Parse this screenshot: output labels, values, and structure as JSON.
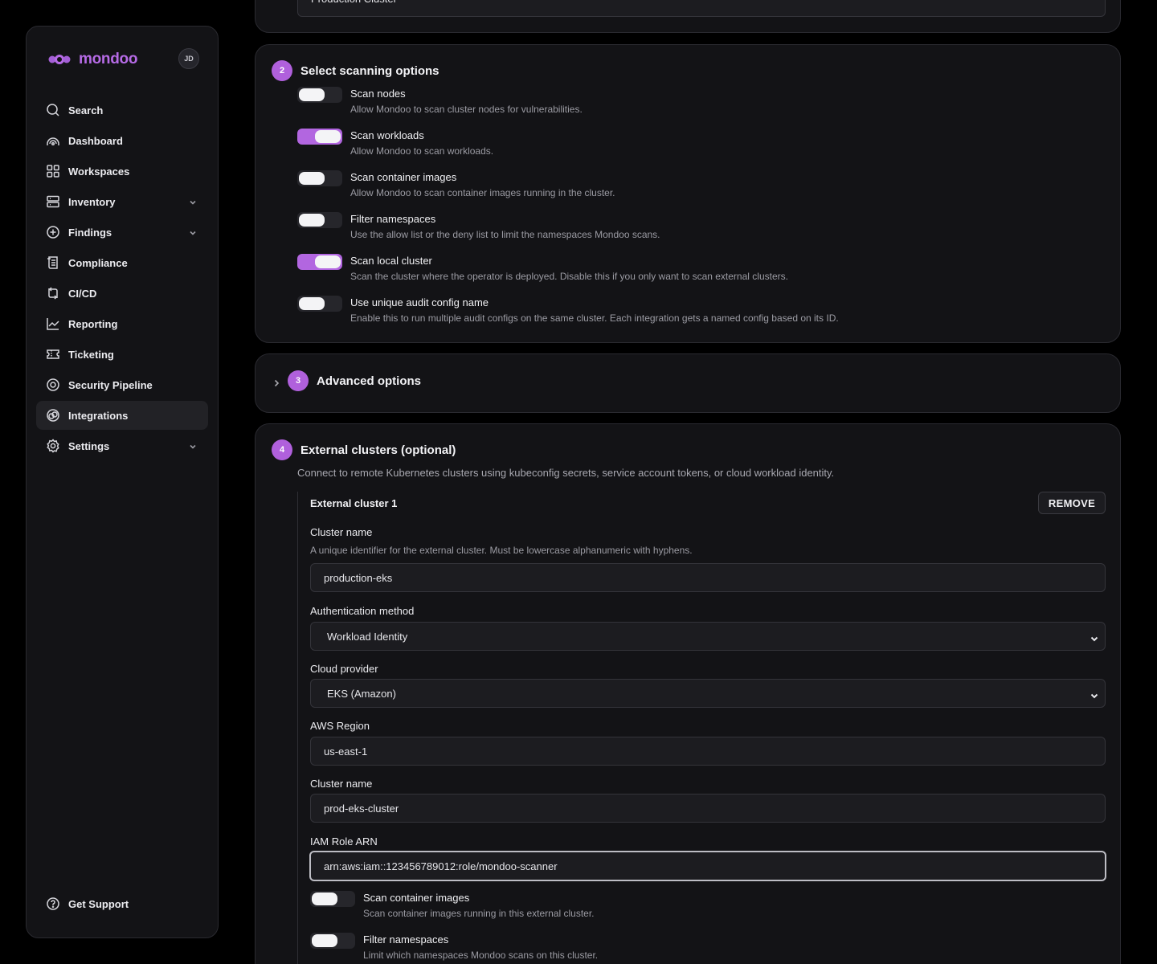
{
  "brand": {
    "name": "mondoo",
    "accent": "#b066e0"
  },
  "user": {
    "initials": "JD"
  },
  "nav": {
    "items": [
      {
        "label": "Search",
        "icon": "search-icon"
      },
      {
        "label": "Dashboard",
        "icon": "dashboard-icon"
      },
      {
        "label": "Workspaces",
        "icon": "workspaces-icon"
      },
      {
        "label": "Inventory",
        "icon": "inventory-icon"
      },
      {
        "label": "Findings",
        "icon": "findings-icon"
      },
      {
        "label": "Compliance",
        "icon": "compliance-icon"
      },
      {
        "label": "CI/CD",
        "icon": "cicd-icon"
      },
      {
        "label": "Reporting",
        "icon": "reporting-icon"
      },
      {
        "label": "Ticketing",
        "icon": "ticketing-icon"
      },
      {
        "label": "Security Pipeline",
        "icon": "security-pipeline-icon"
      },
      {
        "label": "Integrations",
        "icon": "integrations-icon"
      },
      {
        "label": "Settings",
        "icon": "settings-icon"
      }
    ],
    "active": "Integrations",
    "support": "Get Support"
  },
  "top_card": {
    "input_value": "Production Cluster"
  },
  "scan_options": {
    "step": "2",
    "title": "Select scanning options",
    "options": [
      {
        "title": "Scan nodes",
        "desc": "Allow Mondoo to scan cluster nodes for vulnerabilities.",
        "enabled": false
      },
      {
        "title": "Scan workloads",
        "desc": "Allow Mondoo to scan workloads.",
        "enabled": true
      },
      {
        "title": "Scan container images",
        "desc": "Allow Mondoo to scan container images running in the cluster.",
        "enabled": false
      },
      {
        "title": "Filter namespaces",
        "desc": "Use the allow list or the deny list to limit the namespaces Mondoo scans.",
        "enabled": false
      },
      {
        "title": "Scan local cluster",
        "desc": "Scan the cluster where the operator is deployed. Disable this if you only want to scan external clusters.",
        "enabled": true
      },
      {
        "title": "Use unique audit config name",
        "desc": "Enable this to run multiple audit configs on the same cluster. Each integration gets a named config based on its ID.",
        "enabled": false
      }
    ]
  },
  "advanced": {
    "step": "3",
    "title": "Advanced options"
  },
  "external": {
    "step": "4",
    "title": "External clusters (optional)",
    "desc": "Connect to remote Kubernetes clusters using kubeconfig secrets, service account tokens, or cloud workload identity.",
    "cluster": {
      "title": "External cluster 1",
      "remove_label": "REMOVE",
      "name_label": "Cluster name",
      "name_hint": "A unique identifier for the external cluster. Must be lowercase alphanumeric with hyphens.",
      "name_value": "production-eks",
      "auth_label": "Authentication method",
      "auth_value": "Workload Identity",
      "provider_label": "Cloud provider",
      "provider_value": "EKS (Amazon)",
      "region_label": "AWS Region",
      "region_value": "us-east-1",
      "cluster_name_label": "Cluster name",
      "cluster_name_value": "prod-eks-cluster",
      "iam_label": "IAM Role ARN",
      "iam_value": "arn:aws:iam::123456789012:role/mondoo-scanner",
      "options": [
        {
          "title": "Scan container images",
          "desc": "Scan container images running in this external cluster.",
          "enabled": false
        },
        {
          "title": "Filter namespaces",
          "desc": "Limit which namespaces Mondoo scans on this cluster.",
          "enabled": false
        }
      ]
    }
  }
}
